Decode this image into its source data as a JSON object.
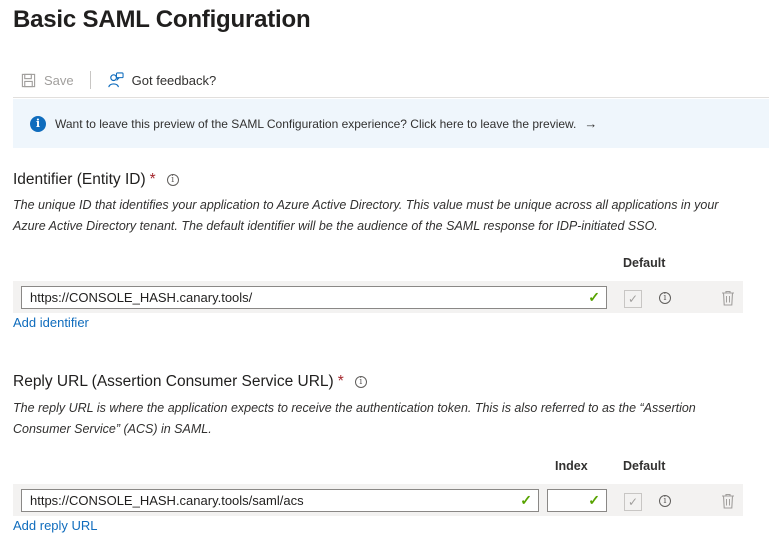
{
  "page": {
    "title": "Basic SAML Configuration"
  },
  "toolbar": {
    "save_label": "Save",
    "feedback_label": "Got feedback?"
  },
  "banner": {
    "text": "Want to leave this preview of the SAML Configuration experience? Click here to leave the preview.",
    "arrow": "→"
  },
  "identifier": {
    "label": "Identifier (Entity ID)",
    "required_mark": "*",
    "description": "The unique ID that identifies your application to Azure Active Directory. This value must be unique across all applications in your Azure Active Directory tenant. The default identifier will be the audience of the SAML response for IDP-initiated SSO.",
    "default_header": "Default",
    "value": "https://CONSOLE_HASH.canary.tools/",
    "is_default": true,
    "add_link": "Add identifier"
  },
  "reply_url": {
    "label": "Reply URL (Assertion Consumer Service URL)",
    "required_mark": "*",
    "description": "The reply URL is where the application expects to receive the authentication token. This is also referred to as the “Assertion Consumer Service” (ACS) in SAML.",
    "index_header": "Index",
    "default_header": "Default",
    "value": "https://CONSOLE_HASH.canary.tools/saml/acs",
    "index_value": "",
    "is_default": true,
    "add_link": "Add reply URL"
  },
  "colors": {
    "accent": "#0f6cbd",
    "valid": "#57a300",
    "required": "#a4262c",
    "banner_bg": "#eff6fc",
    "row_bg": "#f3f2f1"
  },
  "icons": {
    "save": "save-icon",
    "feedback": "feedback-icon",
    "banner_info": "info-icon",
    "delete": "trash-icon",
    "valid": "checkmark-icon"
  }
}
